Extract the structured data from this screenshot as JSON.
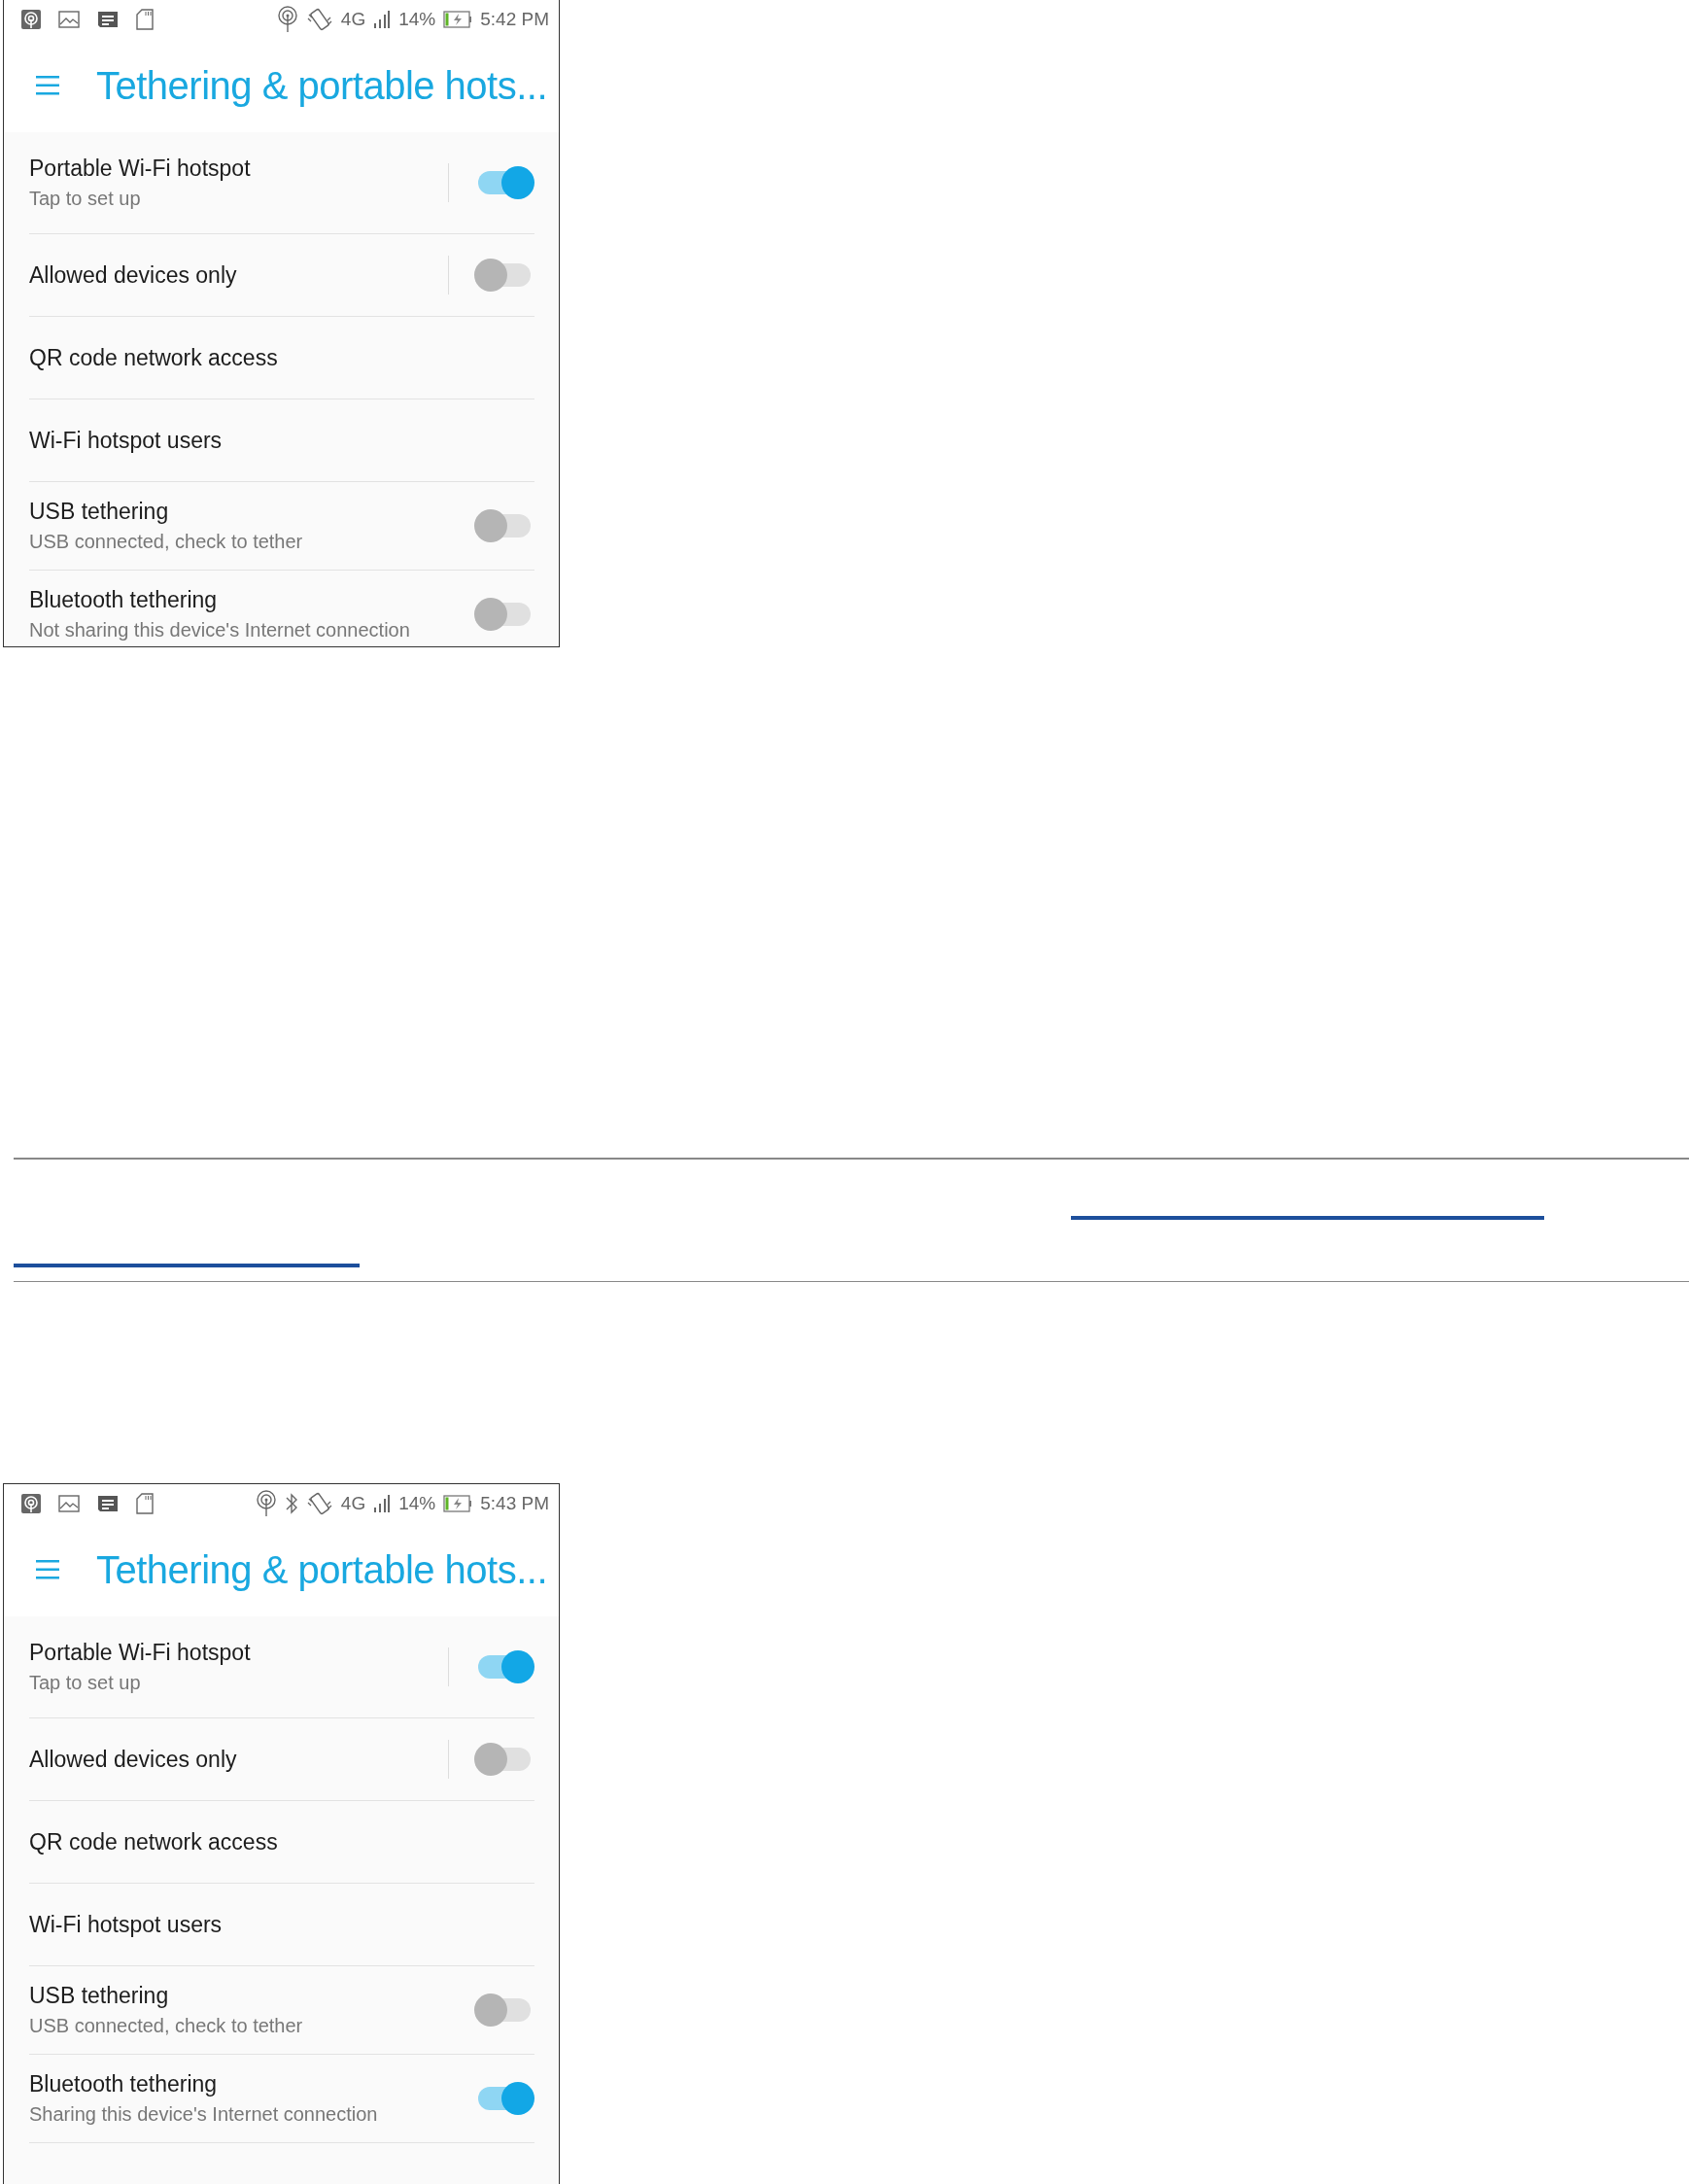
{
  "screens": [
    {
      "status_bar": {
        "network": "4G",
        "battery": "14%",
        "time": "5:42 PM"
      },
      "title": "Tethering & portable hots...",
      "items": [
        {
          "kind": "split-switch",
          "label": "Portable Wi-Fi hotspot",
          "summary": "Tap to set up",
          "on": true
        },
        {
          "kind": "split-switch",
          "label": "Allowed devices only",
          "on": false
        },
        {
          "kind": "plain",
          "label": "QR code network access"
        },
        {
          "kind": "plain",
          "label": "Wi-Fi hotspot users"
        },
        {
          "kind": "switch",
          "label": "USB tethering",
          "summary": "USB connected, check to tether",
          "on": false
        },
        {
          "kind": "switch",
          "label": "Bluetooth tethering",
          "summary": "Not sharing this device's Internet connection",
          "on": false
        }
      ]
    },
    {
      "status_bar": {
        "network": "4G",
        "battery": "14%",
        "time": "5:43 PM",
        "bluetooth": true
      },
      "title": "Tethering & portable hots...",
      "items": [
        {
          "kind": "split-switch",
          "label": "Portable Wi-Fi hotspot",
          "summary": "Tap to set up",
          "on": true
        },
        {
          "kind": "split-switch",
          "label": "Allowed devices only",
          "on": false
        },
        {
          "kind": "plain",
          "label": "QR code network access"
        },
        {
          "kind": "plain",
          "label": "Wi-Fi hotspot users"
        },
        {
          "kind": "switch",
          "label": "USB tethering",
          "summary": "USB connected, check to tether",
          "on": false
        },
        {
          "kind": "switch",
          "label": "Bluetooth tethering",
          "summary": "Sharing this device's Internet connection",
          "on": true
        }
      ]
    }
  ]
}
